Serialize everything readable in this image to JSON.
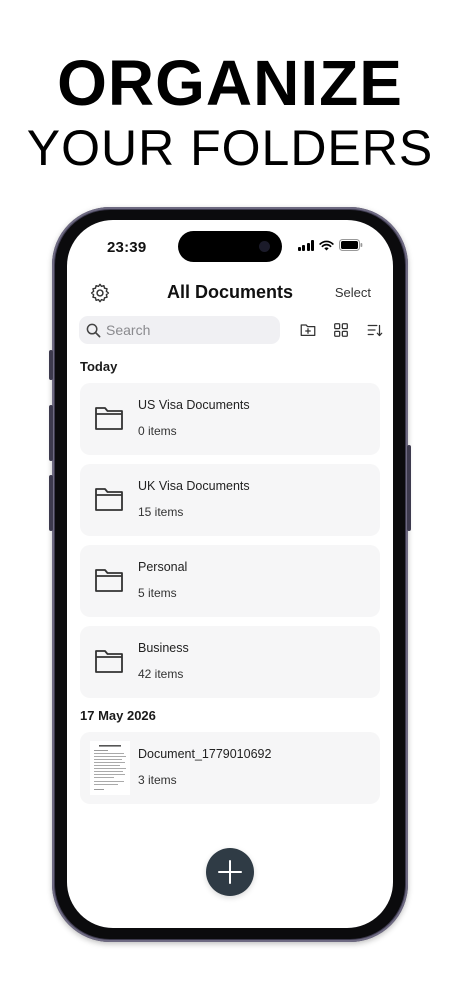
{
  "headline": {
    "line1": "ORGANIZE",
    "line2": "YOUR FOLDERS"
  },
  "status_bar": {
    "time": "23:39"
  },
  "nav": {
    "title": "All Documents",
    "select_label": "Select",
    "settings_icon": "gear-icon"
  },
  "search": {
    "placeholder": "Search"
  },
  "toolbar": {
    "icons": [
      "new-folder-icon",
      "grid-view-icon",
      "sort-icon"
    ]
  },
  "sections": [
    {
      "label": "Today",
      "items": [
        {
          "name": "US Visa Documents",
          "count": "0 items",
          "icon": "folder-icon"
        },
        {
          "name": "UK Visa Documents",
          "count": "15 items",
          "icon": "folder-icon"
        },
        {
          "name": "Personal",
          "count": "5 items",
          "icon": "folder-icon"
        },
        {
          "name": "Business",
          "count": "42 items",
          "icon": "folder-icon"
        }
      ]
    },
    {
      "label": "17 May 2026",
      "items": [
        {
          "name": "Document_1779010692",
          "count": "3 items",
          "icon": "document-thumbnail"
        }
      ]
    }
  ],
  "fab": {
    "icon": "plus-icon"
  },
  "colors": {
    "fab": "#2f3b45",
    "card": "#f6f6f7",
    "search": "#f0f0f3",
    "frame": "#3d3a4e"
  }
}
